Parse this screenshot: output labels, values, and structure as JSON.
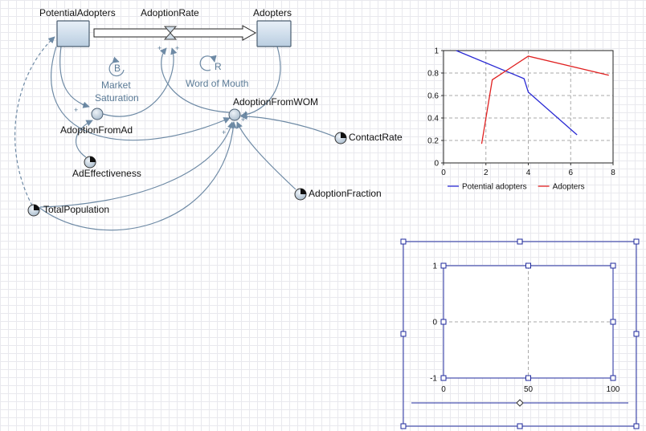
{
  "diagram": {
    "stocks": [
      {
        "id": "potential",
        "label": "PotentialAdopters"
      },
      {
        "id": "adopters",
        "label": "Adopters"
      }
    ],
    "flow": {
      "label": "AdoptionRate"
    },
    "auxiliaries": [
      {
        "id": "fromAd",
        "label": "AdoptionFromAd"
      },
      {
        "id": "fromWom",
        "label": "AdoptionFromWOM"
      }
    ],
    "parameters": [
      {
        "id": "adEff",
        "label": "AdEffectiveness"
      },
      {
        "id": "contact",
        "label": "ContactRate"
      },
      {
        "id": "fraction",
        "label": "AdoptionFraction"
      },
      {
        "id": "total",
        "label": "TotalPopulation"
      }
    ],
    "loops": [
      {
        "symbol": "B",
        "label_line1": "Market",
        "label_line2": "Saturation"
      },
      {
        "symbol": "R",
        "label_line1": "Word of Mouth"
      }
    ],
    "signs": {
      "plus": "+",
      "minus": "-"
    }
  },
  "chart_data": [
    {
      "type": "line",
      "xlim": [
        0,
        8
      ],
      "ylim": [
        0,
        1
      ],
      "x_ticks": [
        "0",
        "2",
        "4",
        "6",
        "8"
      ],
      "y_ticks": [
        "0",
        "0.2",
        "0.4",
        "0.6",
        "0.8",
        "1"
      ],
      "grid": true,
      "legend_position": "bottom",
      "series": [
        {
          "name": "Potential adopters",
          "color": "#2a2ad4",
          "points": [
            [
              0.6,
              1.0
            ],
            [
              3.8,
              0.75
            ],
            [
              4.0,
              0.63
            ],
            [
              6.3,
              0.25
            ]
          ]
        },
        {
          "name": "Adopters",
          "color": "#e02020",
          "points": [
            [
              1.8,
              0.17
            ],
            [
              2.3,
              0.74
            ],
            [
              4.0,
              0.95
            ],
            [
              7.8,
              0.78
            ]
          ]
        }
      ]
    },
    {
      "type": "line",
      "xlim": [
        0,
        100
      ],
      "ylim": [
        -1,
        1
      ],
      "x_ticks": [
        "0",
        "50",
        "100"
      ],
      "y_ticks": [
        "-1",
        "0",
        "1"
      ],
      "grid": true,
      "selected": true,
      "series": [],
      "slider_value": 50
    }
  ]
}
